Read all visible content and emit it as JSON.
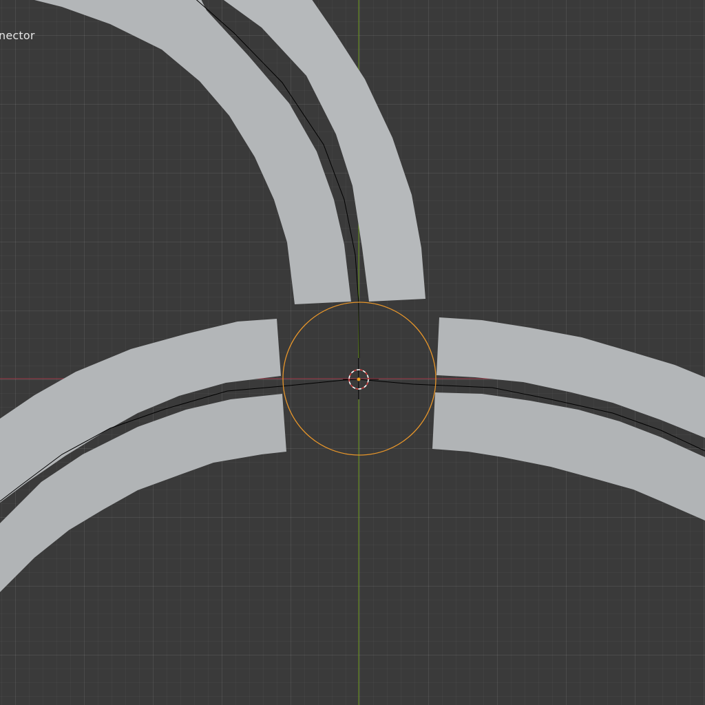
{
  "viewport": {
    "object_label": "nector"
  },
  "colors": {
    "background": "#3a3a3a",
    "track_face": "#b4b7b9",
    "x_axis": "#a13b4a",
    "y_axis": "#6d9a1f",
    "selection_outline": "#e8962a",
    "curve": "#000000",
    "cursor_red": "#d94040",
    "cursor_white": "#ffffff"
  },
  "icons": {
    "cursor": "3d-cursor-icon",
    "origin": "object-origin-icon"
  }
}
